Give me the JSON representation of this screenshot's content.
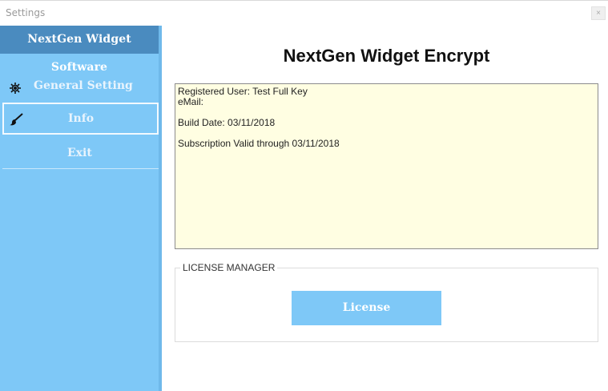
{
  "window": {
    "title": "Settings",
    "close_glyph": "×"
  },
  "sidebar": {
    "brand": "NextGen Widget Software",
    "items": [
      {
        "label": "General Setting",
        "icon": "gear-icon"
      },
      {
        "label": "Info",
        "icon": "brush-icon",
        "selected": true
      },
      {
        "label": "Exit"
      }
    ]
  },
  "main": {
    "title": "NextGen Widget Encrypt",
    "info": {
      "registered_user": "Registered User: Test Full Key",
      "email": "eMail:",
      "build_date": "Build Date: 03/11/2018",
      "subscription": "Subscription Valid through 03/11/2018"
    },
    "license_manager": {
      "caption": "LICENSE MANAGER",
      "button_label": "License"
    }
  },
  "colors": {
    "sidebar": "#7ec8f7",
    "brand_bar": "#4a8bbf",
    "info_background": "#fffee2",
    "button": "#7ec8f7"
  }
}
